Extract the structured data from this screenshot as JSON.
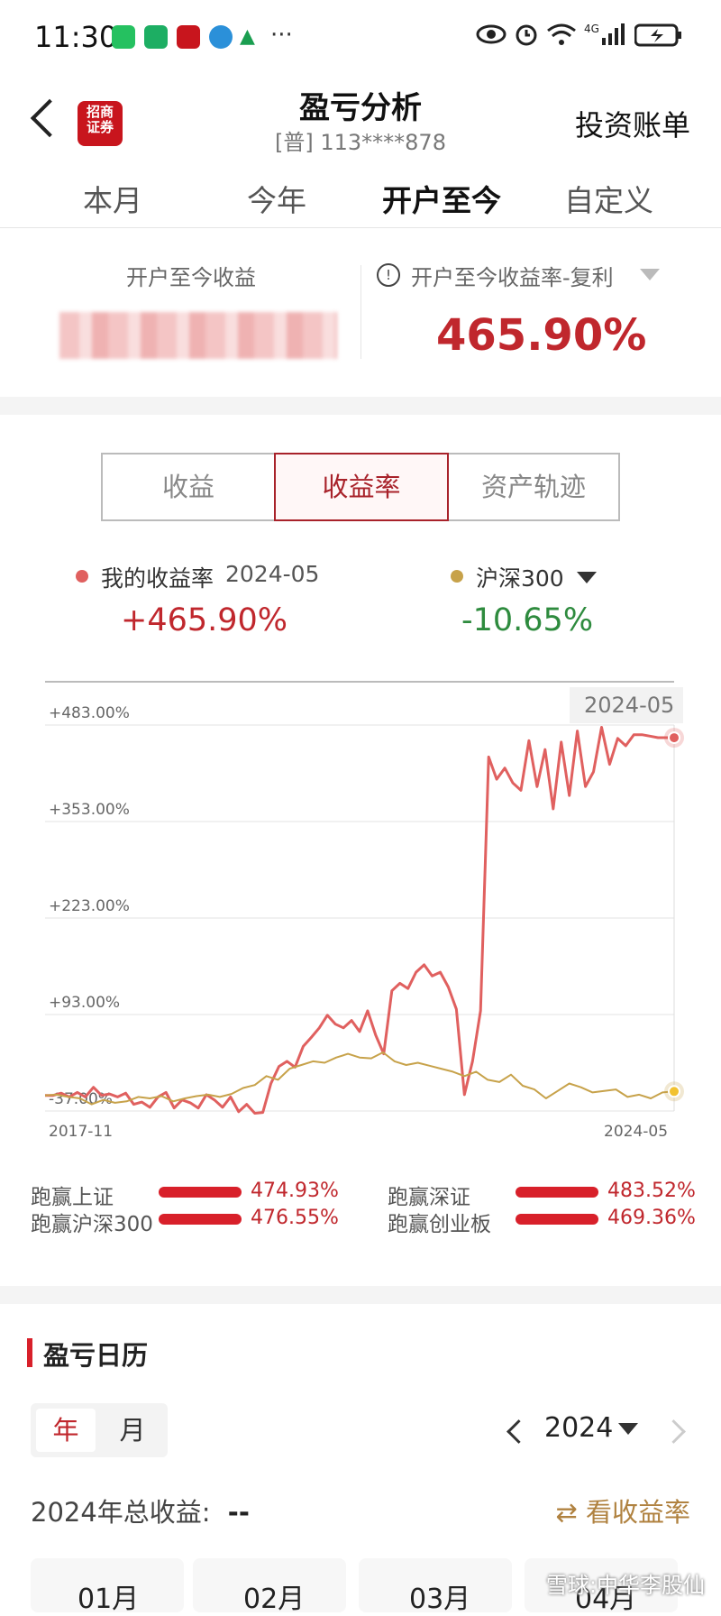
{
  "status_bar": {
    "time": "11:30",
    "dots": "···"
  },
  "header": {
    "logo_text_1": "招商",
    "logo_text_2": "证券",
    "title": "盈亏分析",
    "account": "[普] 113****878",
    "bill_link": "投资账单"
  },
  "period_tabs": [
    {
      "label": "本月",
      "active": false
    },
    {
      "label": "今年",
      "active": false
    },
    {
      "label": "开户至今",
      "active": true
    },
    {
      "label": "自定义",
      "active": false
    }
  ],
  "summary": {
    "income_label": "开户至今收益",
    "rate_label": "开户至今收益率-复利",
    "rate_value": "465.90%"
  },
  "segments": [
    {
      "label": "收益",
      "active": false
    },
    {
      "label": "收益率",
      "active": true
    },
    {
      "label": "资产轨迹",
      "active": false
    }
  ],
  "legend": {
    "mine_label": "我的收益率",
    "mine_date": "2024-05",
    "mine_value": "+465.90%",
    "bench_label": "沪深300",
    "bench_value": "-10.65%",
    "colors": {
      "mine": "#e0605f",
      "bench": "#c7a24a",
      "up": "#c0272d",
      "down": "#2e8b3e"
    }
  },
  "chart_data": {
    "type": "line",
    "x_start": "2017-11",
    "x_end": "2024-05",
    "tooltip_date": "2024-05",
    "y_ticks": [
      "+483.00%",
      "+353.00%",
      "+223.00%",
      "+93.00%",
      "-37.00%"
    ],
    "ylim": [
      -37,
      483
    ],
    "grid": true,
    "series": [
      {
        "name": "我的收益率",
        "values": [
          -16,
          -16,
          -13,
          -18,
          -12,
          -18,
          -5,
          -16,
          -14,
          -18,
          -13,
          -28,
          -25,
          -32,
          -18,
          -12,
          -33,
          -22,
          -26,
          -33,
          -15,
          -22,
          -32,
          -18,
          -38,
          -28,
          -40,
          -39,
          0,
          23,
          30,
          22,
          50,
          62,
          75,
          92,
          80,
          75,
          85,
          70,
          98,
          65,
          40,
          125,
          135,
          128,
          150,
          160,
          145,
          150,
          130,
          100,
          -15,
          30,
          98,
          440,
          410,
          425,
          405,
          395,
          462,
          400,
          450,
          370,
          460,
          388,
          475,
          400,
          420,
          480,
          430,
          465,
          455,
          470,
          470,
          468,
          466,
          466,
          465.9
        ],
        "color": "#e0605f"
      },
      {
        "name": "沪深300",
        "values": [
          -16,
          -15,
          -18,
          -20,
          -28,
          -22,
          -26,
          -24,
          -18,
          -20,
          -17,
          -24,
          -20,
          -17,
          -15,
          -18,
          -14,
          -6,
          -2,
          10,
          5,
          20,
          25,
          30,
          28,
          35,
          40,
          35,
          34,
          42,
          30,
          25,
          28,
          24,
          20,
          16,
          10,
          16,
          5,
          2,
          12,
          -3,
          -8,
          -20,
          -10,
          0,
          -5,
          -12,
          -10,
          -8,
          -18,
          -15,
          -20,
          -12,
          -10.65
        ],
        "color": "#c7a24a"
      }
    ]
  },
  "beats": [
    {
      "label": "跑赢上证",
      "value": "474.93%"
    },
    {
      "label": "跑赢深证",
      "value": "483.52%"
    },
    {
      "label": "跑赢沪深300",
      "value": "476.55%"
    },
    {
      "label": "跑赢创业板",
      "value": "469.36%"
    }
  ],
  "calendar": {
    "section_title": "盈亏日历",
    "year_btn": "年",
    "month_btn": "月",
    "year": "2024",
    "total_label": "2024年总收益:",
    "total_value": "--",
    "view_rate": "看收益率",
    "view_icon": "⇄",
    "months": [
      "01月",
      "02月",
      "03月",
      "04月"
    ]
  },
  "watermark": "雪球:中华李股仙"
}
